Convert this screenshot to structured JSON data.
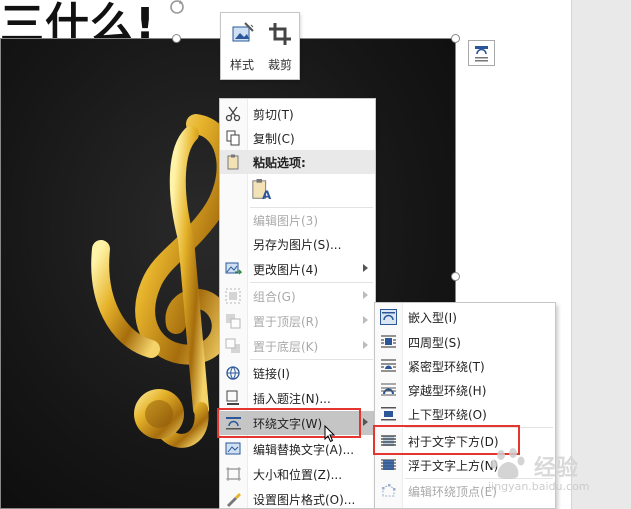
{
  "document": {
    "title_fragment": "三什么!"
  },
  "mini_toolbar": {
    "style_label": "样式",
    "crop_label": "裁剪"
  },
  "context_menu": {
    "cut": "剪切(T)",
    "copy": "复制(C)",
    "paste_options": "粘贴选项:",
    "edit_picture": "编辑图片(3)",
    "save_as_picture": "另存为图片(S)...",
    "change_picture": "更改图片(4)",
    "group": "组合(G)",
    "bring_to_front": "置于顶层(R)",
    "send_to_back": "置于底层(K)",
    "link": "链接(I)",
    "insert_caption": "插入题注(N)...",
    "wrap_text": "环绕文字(W)",
    "edit_alt_text": "编辑替换文字(A)...",
    "size_position": "大小和位置(Z)...",
    "format_picture": "设置图片格式(O)..."
  },
  "wrap_submenu": {
    "inline": "嵌入型(I)",
    "square": "四周型(S)",
    "tight": "紧密型环绕(T)",
    "through": "穿越型环绕(H)",
    "top_bottom": "上下型环绕(O)",
    "behind_text": "衬于文字下方(D)",
    "in_front_of_text": "浮于文字上方(N)",
    "edit_wrap_points": "编辑环绕顶点(E)"
  },
  "watermark": {
    "brand": "经验",
    "url": "jingyan.baidu.com"
  },
  "colors": {
    "highlight": "#c5c5c5",
    "annotation_red": "#e4362f",
    "icon_blue": "#2b579a"
  }
}
